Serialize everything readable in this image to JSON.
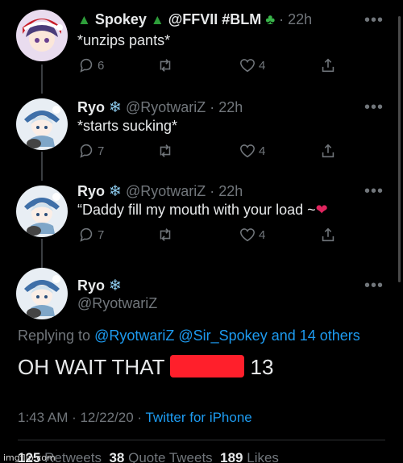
{
  "tweets": [
    {
      "name": "Spokey",
      "handle": "@FFVII #BLM",
      "time": "22h",
      "text": "*unzips pants*",
      "replies": "6",
      "retweets": "",
      "likes": "4"
    },
    {
      "name": "Ryo",
      "handle": "@RyotwariZ",
      "time": "22h",
      "text": "*starts sucking*",
      "replies": "7",
      "retweets": "",
      "likes": "4"
    },
    {
      "name": "Ryo",
      "handle": "@RyotwariZ",
      "time": "22h",
      "text": "“Daddy fill my mouth with your load ~",
      "replies": "7",
      "retweets": "",
      "likes": "4"
    }
  ],
  "main": {
    "name": "Ryo",
    "handle": "@RyotwariZ",
    "replying_prefix": "Replying to",
    "replying_user1": "@RyotwariZ",
    "replying_user2": "@Sir_Spokey",
    "replying_others": "and 14 others",
    "text_before": "OH WAIT THAT",
    "text_after": "13",
    "time": "1:43 AM · 12/22/20 ·",
    "source": "Twitter for iPhone",
    "retweets_count": "125",
    "retweets_label": "Retweets",
    "quotes_count": "38",
    "quotes_label": "Quote Tweets",
    "likes_count": "189",
    "likes_label": "Likes"
  },
  "separator": "·",
  "more_label": "•••",
  "watermark": "imgflip.com",
  "colors": {
    "background": "#000000",
    "link": "#1d9bf0",
    "muted": "#71767b",
    "redaction": "#ff1f2b"
  }
}
